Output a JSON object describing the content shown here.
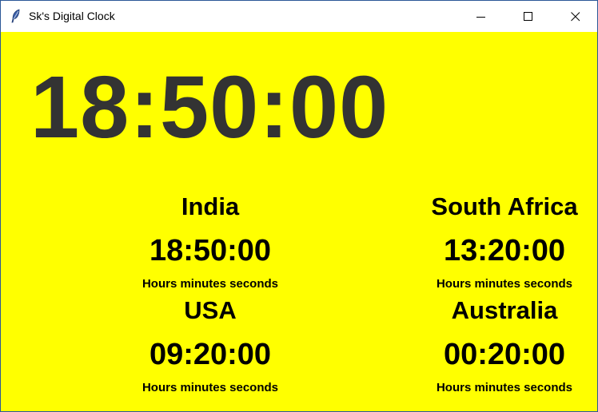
{
  "window": {
    "title": "Sk's Digital Clock",
    "icon": "feather-icon",
    "controls": [
      "minimize-icon",
      "maximize-icon",
      "close-icon"
    ]
  },
  "colors": {
    "background": "#ffff00",
    "main_clock_text": "#333333",
    "zone_text": "#000000"
  },
  "main_clock": {
    "time": "18:50:00"
  },
  "zones": [
    {
      "name": "India",
      "time": "18:50:00",
      "caption": "Hours minutes seconds"
    },
    {
      "name": "South Africa",
      "time": "13:20:00",
      "caption": "Hours minutes seconds"
    },
    {
      "name": "USA",
      "time": "09:20:00",
      "caption": "Hours minutes seconds"
    },
    {
      "name": "Australia",
      "time": "00:20:00",
      "caption": "Hours minutes seconds"
    }
  ]
}
